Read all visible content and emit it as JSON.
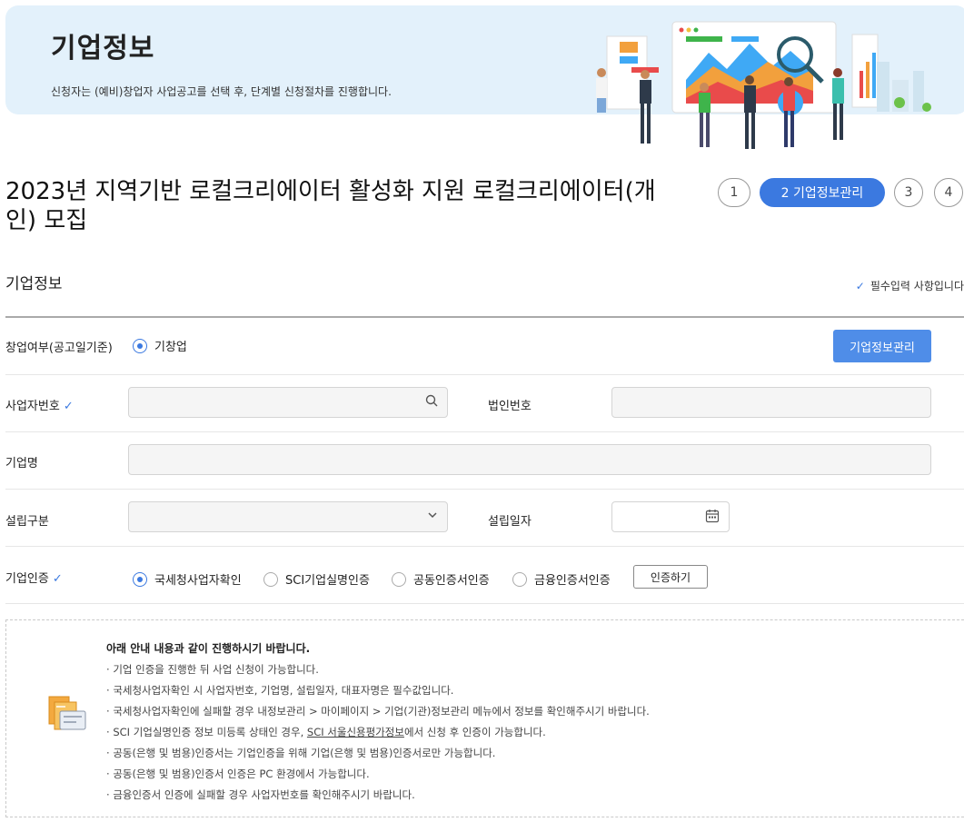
{
  "banner": {
    "title": "기업정보",
    "description": "신청자는 (예비)창업자 사업공고를 선택 후, 단계별 신청절차를 진행합니다."
  },
  "page_title": "2023년 지역기반 로컬크리에이터 활성화 지원 로컬크리에이터(개인) 모집",
  "steps": [
    {
      "label": "1"
    },
    {
      "label": "2  기업정보관리"
    },
    {
      "label": "3"
    },
    {
      "label": "4"
    }
  ],
  "section": {
    "title": "기업정보",
    "required_note": "필수입력 사항입니다"
  },
  "form": {
    "startup_status": {
      "label": "창업여부(공고일기준)",
      "option": "기창업"
    },
    "manage_button": "기업정보관리",
    "business_number": {
      "label": "사업자번호",
      "value": ""
    },
    "corp_number": {
      "label": "법인번호",
      "value": ""
    },
    "company_name": {
      "label": "기업명",
      "value": ""
    },
    "founding_type": {
      "label": "설립구분",
      "value": ""
    },
    "founding_date": {
      "label": "설립일자",
      "value": ""
    },
    "certification": {
      "label": "기업인증",
      "options": [
        "국세청사업자확인",
        "SCI기업실명인증",
        "공동인증서인증",
        "금융인증서인증"
      ],
      "selected": "국세청사업자확인",
      "button": "인증하기"
    }
  },
  "guide": {
    "title": "아래 안내 내용과 같이 진행하시기 바랍니다.",
    "items": [
      "기업 인증을 진행한 뒤 사업 신청이 가능합니다.",
      "국세청사업자확인 시 사업자번호, 기업명, 설립일자, 대표자명은 필수값입니다.",
      "국세청사업자확인에 실패할 경우 내정보관리 > 마이페이지 > 기업(기관)정보관리 메뉴에서 정보를 확인해주시기 바랍니다.",
      "SCI 기업실명인증 정보 미등록 상태인 경우, ",
      "공동(은행 및 범용)인증서는 기업인증을 위해 기업(은행 및 범용)인증서로만 가능합니다.",
      "공동(은행 및 범용)인증서 인증은 PC 환경에서 가능합니다.",
      "금융인증서 인증에 실패할 경우 사업자번호를 확인해주시기 바랍니다."
    ],
    "sci_link": "SCI 서울신용평가정보",
    "sci_suffix": "에서 신청 후 인증이 가능합니다."
  },
  "icons": {
    "search": "search-icon",
    "dropdown": "chevron-down-icon",
    "calendar": "calendar-icon",
    "check": "check-icon",
    "guide": "document-card-icon"
  },
  "colors": {
    "accent": "#3b79e0",
    "banner_bg": "#e3f1fb",
    "button": "#4f8de8"
  }
}
